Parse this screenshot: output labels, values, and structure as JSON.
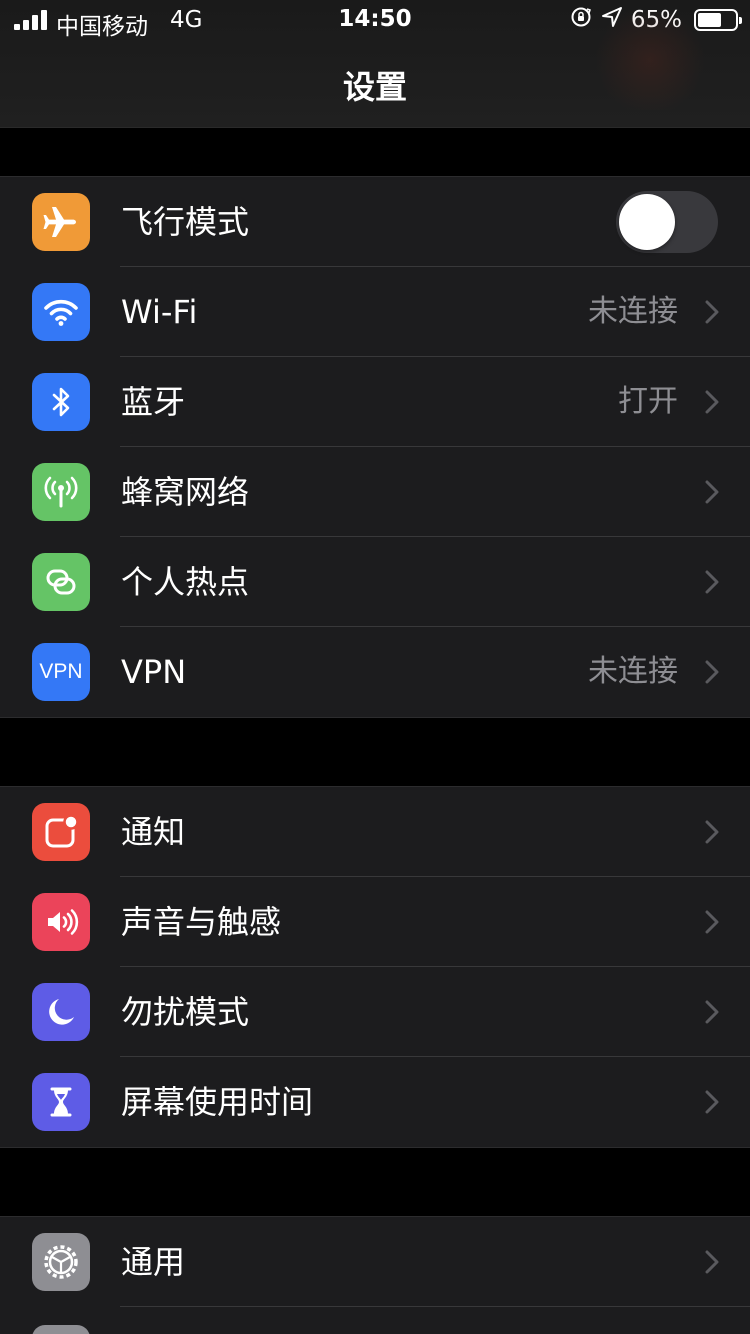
{
  "status_bar": {
    "carrier": "中国移动",
    "network": "4G",
    "time": "14:50",
    "battery_percent": "65%",
    "battery_level": 0.65,
    "icons": [
      "signal-icon",
      "orientation-lock-icon",
      "location-icon",
      "battery-icon"
    ]
  },
  "nav": {
    "title": "设置"
  },
  "groups": [
    {
      "rows": [
        {
          "label": "飞行模式",
          "icon": "airplane-icon",
          "color": "#f09a37",
          "toggle": false
        },
        {
          "label": "Wi-Fi",
          "icon": "wifi-icon",
          "color": "#3478f6",
          "value": "未连接"
        },
        {
          "label": "蓝牙",
          "icon": "bluetooth-icon",
          "color": "#3478f6",
          "value": "打开"
        },
        {
          "label": "蜂窝网络",
          "icon": "cellular-icon",
          "color": "#65c466"
        },
        {
          "label": "个人热点",
          "icon": "hotspot-icon",
          "color": "#65c466"
        },
        {
          "label": "VPN",
          "icon": "vpn-icon",
          "color": "#3478f6",
          "value": "未连接",
          "icon_text": "VPN"
        }
      ]
    },
    {
      "rows": [
        {
          "label": "通知",
          "icon": "notifications-icon",
          "color": "#eb4d3d"
        },
        {
          "label": "声音与触感",
          "icon": "sound-icon",
          "color": "#eb445a"
        },
        {
          "label": "勿扰模式",
          "icon": "moon-icon",
          "color": "#5e5ce6"
        },
        {
          "label": "屏幕使用时间",
          "icon": "hourglass-icon",
          "color": "#5e5ce6"
        }
      ]
    },
    {
      "rows": [
        {
          "label": "通用",
          "icon": "gear-icon",
          "color": "#8e8e93"
        }
      ]
    }
  ]
}
